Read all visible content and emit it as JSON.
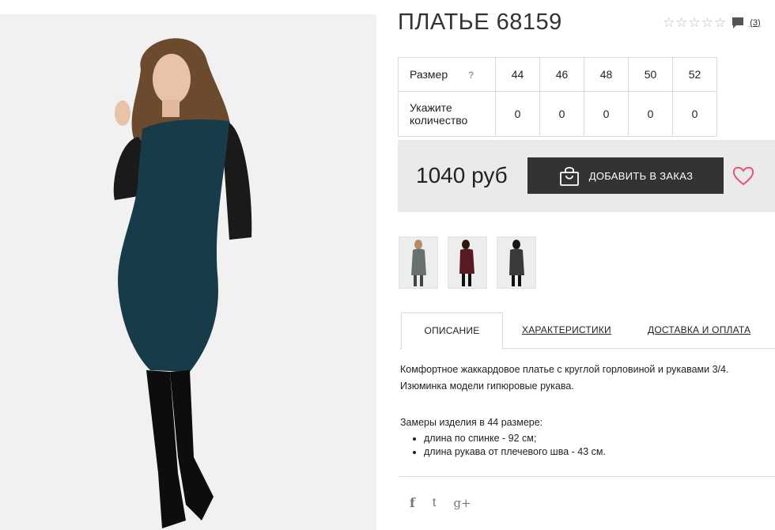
{
  "product": {
    "title": "ПЛАТЬЕ 68159",
    "review_count": "(3)",
    "rating": 0
  },
  "sizes": {
    "size_label": "Размер",
    "help": "?",
    "qty_label": "Укажите количество",
    "values": [
      "44",
      "46",
      "48",
      "50",
      "52"
    ],
    "quantities": [
      "0",
      "0",
      "0",
      "0",
      "0"
    ]
  },
  "buy": {
    "price": "1040 руб",
    "add_button": "ДОБАВИТЬ В ЗАКАЗ"
  },
  "thumbnails": [
    {
      "dress_color": "#6a7070"
    },
    {
      "dress_color": "#5a1a24"
    },
    {
      "dress_color": "#3a3a3a"
    }
  ],
  "tabs": [
    "ОПИСАНИЕ",
    "ХАРАКТЕРИСТИКИ",
    "ДОСТАВКА И ОПЛАТА"
  ],
  "description": {
    "line1": "Комфортное жаккардовое платье с круглой горловиной и рукавами 3/4.",
    "line2": "Изюминка модели гипюровые рукава.",
    "measurements_title": "Замеры изделия в 44 размере:",
    "measurements": [
      "длина по спинке - 92 см;",
      "длина рукава от плечевого шва - 43 см."
    ]
  },
  "social": [
    "f",
    "t",
    "g+"
  ],
  "colors": {
    "button": "#333333",
    "buybar": "#eaeaea",
    "wishlist": "#e0567a",
    "dress": "#183b4a"
  }
}
